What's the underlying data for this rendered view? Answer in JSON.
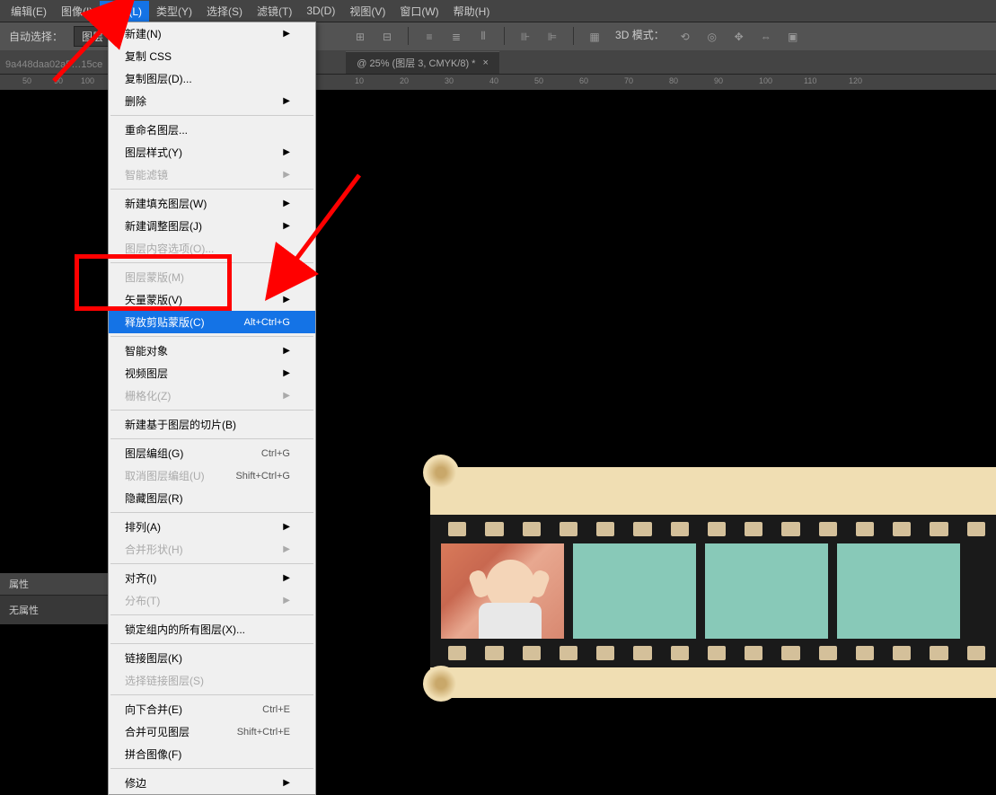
{
  "menubar": {
    "items": [
      "编辑(E)",
      "图像(I)",
      "图层(L)",
      "类型(Y)",
      "选择(S)",
      "滤镜(T)",
      "3D(D)",
      "视图(V)",
      "窗口(W)",
      "帮助(H)"
    ],
    "open_index": 2
  },
  "optionbar": {
    "auto_select": "自动选择：",
    "layer_dropdown": "图层",
    "mode_label": "3D 模式："
  },
  "tabs": {
    "faded": "9a448daa02a5…15ce",
    "active": "@ 25% (图层 3, CMYK/8) *"
  },
  "ruler_marks": [
    "50",
    "90",
    "100",
    "10",
    "20",
    "30",
    "40",
    "50",
    "60",
    "70",
    "80",
    "90",
    "100",
    "110",
    "120"
  ],
  "layer_menu": [
    {
      "label": "新建(N)",
      "arrow": true
    },
    {
      "label": "复制 CSS"
    },
    {
      "label": "复制图层(D)..."
    },
    {
      "label": "删除",
      "arrow": true
    },
    {
      "sep": true
    },
    {
      "label": "重命名图层..."
    },
    {
      "label": "图层样式(Y)",
      "arrow": true
    },
    {
      "label": "智能滤镜",
      "arrow": true,
      "disabled": true
    },
    {
      "sep": true
    },
    {
      "label": "新建填充图层(W)",
      "arrow": true
    },
    {
      "label": "新建调整图层(J)",
      "arrow": true
    },
    {
      "label": "图层内容选项(O)...",
      "disabled": true
    },
    {
      "sep": true
    },
    {
      "label": "图层蒙版(M)",
      "arrow": true,
      "disabled": true
    },
    {
      "label": "矢量蒙版(V)",
      "arrow": true
    },
    {
      "label": "释放剪贴蒙版(C)",
      "shortcut": "Alt+Ctrl+G",
      "highlighted": true
    },
    {
      "sep": true
    },
    {
      "label": "智能对象",
      "arrow": true
    },
    {
      "label": "视频图层",
      "arrow": true
    },
    {
      "label": "栅格化(Z)",
      "arrow": true,
      "disabled": true
    },
    {
      "sep": true
    },
    {
      "label": "新建基于图层的切片(B)"
    },
    {
      "sep": true
    },
    {
      "label": "图层编组(G)",
      "shortcut": "Ctrl+G"
    },
    {
      "label": "取消图层编组(U)",
      "shortcut": "Shift+Ctrl+G",
      "disabled": true
    },
    {
      "label": "隐藏图层(R)"
    },
    {
      "sep": true
    },
    {
      "label": "排列(A)",
      "arrow": true
    },
    {
      "label": "合并形状(H)",
      "arrow": true,
      "disabled": true
    },
    {
      "sep": true
    },
    {
      "label": "对齐(I)",
      "arrow": true
    },
    {
      "label": "分布(T)",
      "arrow": true,
      "disabled": true
    },
    {
      "sep": true
    },
    {
      "label": "锁定组内的所有图层(X)..."
    },
    {
      "sep": true
    },
    {
      "label": "链接图层(K)"
    },
    {
      "label": "选择链接图层(S)",
      "disabled": true
    },
    {
      "sep": true
    },
    {
      "label": "向下合并(E)",
      "shortcut": "Ctrl+E"
    },
    {
      "label": "合并可见图层",
      "shortcut": "Shift+Ctrl+E"
    },
    {
      "label": "拼合图像(F)"
    },
    {
      "sep": true
    },
    {
      "label": "修边",
      "arrow": true
    }
  ],
  "properties": {
    "tab": "属性",
    "none": "无属性"
  }
}
